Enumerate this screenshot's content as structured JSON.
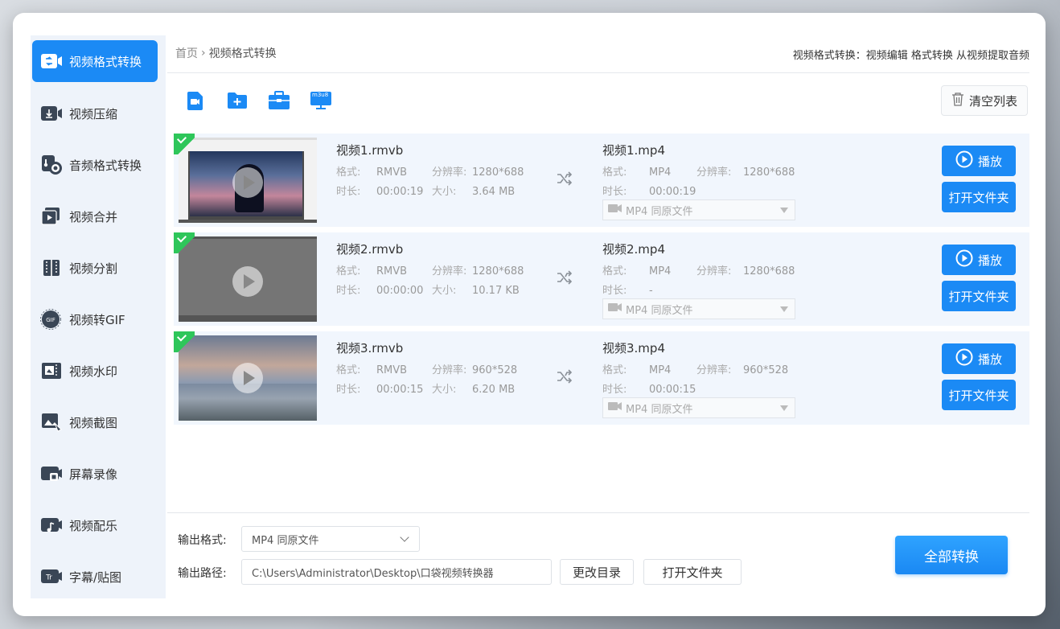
{
  "sidebar": {
    "items": [
      {
        "label": "视频格式转换",
        "icon": "video-convert-icon",
        "active": true
      },
      {
        "label": "视频压缩",
        "icon": "video-compress-icon"
      },
      {
        "label": "音频格式转换",
        "icon": "audio-convert-icon"
      },
      {
        "label": "视频合并",
        "icon": "video-merge-icon"
      },
      {
        "label": "视频分割",
        "icon": "video-split-icon"
      },
      {
        "label": "视频转GIF",
        "icon": "gif-icon"
      },
      {
        "label": "视频水印",
        "icon": "watermark-icon"
      },
      {
        "label": "视频截图",
        "icon": "screenshot-icon"
      },
      {
        "label": "屏幕录像",
        "icon": "screen-record-icon"
      },
      {
        "label": "视频配乐",
        "icon": "music-icon"
      },
      {
        "label": "字幕/贴图",
        "icon": "subtitle-icon"
      }
    ]
  },
  "header": {
    "breadcrumb_home": "首页",
    "breadcrumb_sep": "›",
    "breadcrumb_current": "视频格式转换",
    "right_text": "视频格式转换：视频编辑 格式转换 从视频提取音频"
  },
  "toolbar": {
    "m3u8_label": "m3u8",
    "clear_label": "清空列表"
  },
  "labels": {
    "format": "格式:",
    "resolution": "分辨率:",
    "duration": "时长:",
    "size": "大小:",
    "play": "播放",
    "open_folder": "打开文件夹"
  },
  "files": [
    {
      "src_name": "视频1.rmvb",
      "src_format": "RMVB",
      "src_resolution": "1280*688",
      "src_duration": "00:00:19",
      "src_size": "3.64 MB",
      "dst_name": "视频1.mp4",
      "dst_format": "MP4",
      "dst_resolution": "1280*688",
      "dst_duration": "00:00:19",
      "dst_select": "MP4  同原文件"
    },
    {
      "src_name": "视频2.rmvb",
      "src_format": "RMVB",
      "src_resolution": "1280*688",
      "src_duration": "00:00:00",
      "src_size": "10.17 KB",
      "dst_name": "视频2.mp4",
      "dst_format": "MP4",
      "dst_resolution": "1280*688",
      "dst_duration": "-",
      "dst_select": "MP4  同原文件"
    },
    {
      "src_name": "视频3.rmvb",
      "src_format": "RMVB",
      "src_resolution": "960*528",
      "src_duration": "00:00:15",
      "src_size": "6.20 MB",
      "dst_name": "视频3.mp4",
      "dst_format": "MP4",
      "dst_resolution": "960*528",
      "dst_duration": "00:00:15",
      "dst_select": "MP4  同原文件"
    }
  ],
  "bottom": {
    "output_format_label": "输出格式:",
    "output_format_value": "MP4  同原文件",
    "output_path_label": "输出路径:",
    "output_path_value": "C:\\Users\\Administrator\\Desktop\\口袋视频转换器",
    "change_dir": "更改目录",
    "open_folder": "打开文件夹",
    "convert_all": "全部转换"
  },
  "colors": {
    "accent": "#1b8af5",
    "check": "#2ec65a",
    "row_bg": "#f1f6fd"
  }
}
